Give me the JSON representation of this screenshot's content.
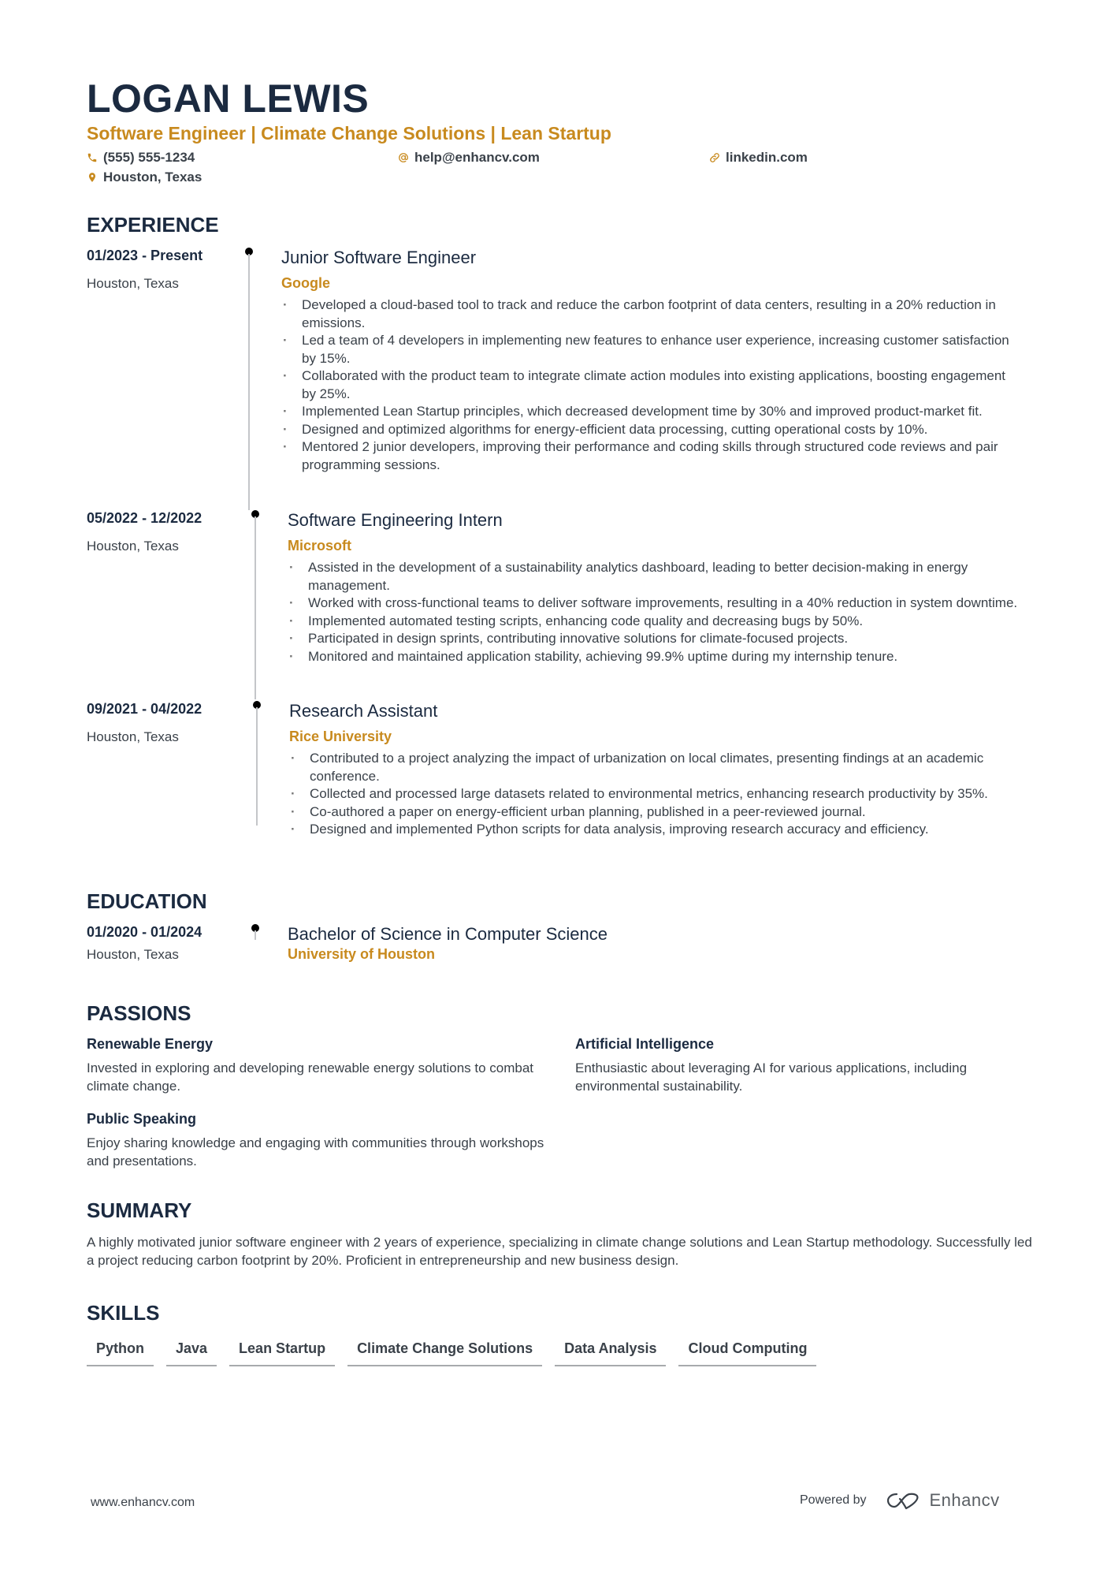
{
  "header": {
    "name": "LOGAN LEWIS",
    "headline": "Software Engineer | Climate Change Solutions | Lean Startup",
    "phone": "(555) 555-1234",
    "email": "help@enhancv.com",
    "linkedin": "linkedin.com",
    "location": "Houston, Texas",
    "accent_color": "#c88a1e",
    "title_color": "#1b2a40"
  },
  "experience": {
    "title": "EXPERIENCE",
    "entries": [
      {
        "date": "01/2023 - Present",
        "location": "Houston, Texas",
        "role": "Junior Software Engineer",
        "company": "Google",
        "bullets": [
          "Developed a cloud-based tool to track and reduce the carbon footprint of data centers, resulting in a 20% reduction in emissions.",
          "Led a team of 4 developers in implementing new features to enhance user experience, increasing customer satisfaction by 15%.",
          "Collaborated with the product team to integrate climate action modules into existing applications, boosting engagement by 25%.",
          "Implemented Lean Startup principles, which decreased development time by 30% and improved product-market fit.",
          "Designed and optimized algorithms for energy-efficient data processing, cutting operational costs by 10%.",
          "Mentored 2 junior developers, improving their performance and coding skills through structured code reviews and pair programming sessions."
        ]
      },
      {
        "date": "05/2022 - 12/2022",
        "location": "Houston, Texas",
        "role": "Software Engineering Intern",
        "company": "Microsoft",
        "bullets": [
          "Assisted in the development of a sustainability analytics dashboard, leading to better decision-making in energy management.",
          "Worked with cross-functional teams to deliver software improvements, resulting in a 40% reduction in system downtime.",
          "Implemented automated testing scripts, enhancing code quality and decreasing bugs by 50%.",
          "Participated in design sprints, contributing innovative solutions for climate-focused projects.",
          "Monitored and maintained application stability, achieving 99.9% uptime during my internship tenure."
        ]
      },
      {
        "date": "09/2021 - 04/2022",
        "location": "Houston, Texas",
        "role": "Research Assistant",
        "company": "Rice University",
        "bullets": [
          "Contributed to a project analyzing the impact of urbanization on local climates, presenting findings at an academic conference.",
          "Collected and processed large datasets related to environmental metrics, enhancing research productivity by 35%.",
          "Co-authored a paper on energy-efficient urban planning, published in a peer-reviewed journal.",
          "Designed and implemented Python scripts for data analysis, improving research accuracy and efficiency."
        ]
      }
    ]
  },
  "education": {
    "title": "EDUCATION",
    "entries": [
      {
        "date": "01/2020 - 01/2024",
        "location": "Houston, Texas",
        "degree": "Bachelor of Science in Computer Science",
        "school": "University of Houston"
      }
    ]
  },
  "passions": {
    "title": "PASSIONS",
    "items": [
      {
        "title": "Renewable Energy",
        "description": "Invested in exploring and developing renewable energy solutions to combat climate change."
      },
      {
        "title": "Artificial Intelligence",
        "description": "Enthusiastic about leveraging AI for various applications, including environmental sustainability."
      },
      {
        "title": "Public Speaking",
        "description": "Enjoy sharing knowledge and engaging with communities through workshops and presentations."
      }
    ]
  },
  "summary": {
    "title": "SUMMARY",
    "text": "A highly motivated junior software engineer with 2 years of experience, specializing in climate change solutions and Lean Startup methodology. Successfully led a project reducing carbon footprint by 20%. Proficient in entrepreneurship and new business design."
  },
  "skills": {
    "title": "SKILLS",
    "items": [
      "Python",
      "Java",
      "Lean Startup",
      "Climate Change Solutions",
      "Data Analysis",
      "Cloud Computing"
    ]
  },
  "footer": {
    "website": "www.enhancv.com",
    "powered_by": "Powered by",
    "brand": "Enhancv"
  }
}
